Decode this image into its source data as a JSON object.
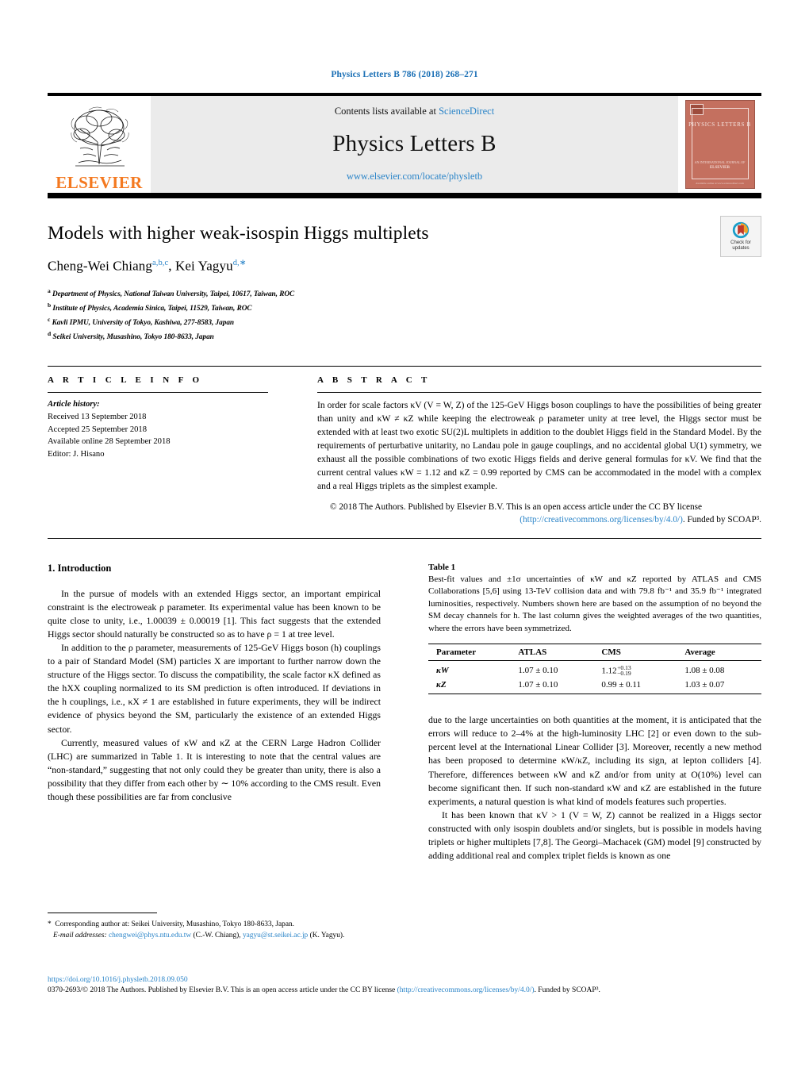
{
  "running_head": "Physics Letters B 786 (2018) 268–271",
  "masthead": {
    "publisher": "ELSEVIER",
    "contents_prefix": "Contents lists available at ",
    "contents_link": "ScienceDirect",
    "journal_name": "Physics Letters B",
    "journal_url": "www.elsevier.com/locate/physletb",
    "cover_title": "PHYSICS LETTERS B",
    "cover_footer_line1": "AN INTERNATIONAL JOURNAL OF",
    "cover_footer_line2": "ELSEVIER",
    "cover_bottom": "Available online at www.sciencedirect.com"
  },
  "article": {
    "title": "Models with higher weak-isospin Higgs multiplets",
    "authors": [
      {
        "name": "Cheng-Wei Chiang",
        "marks": "a,b,c",
        "sep": ", "
      },
      {
        "name": "Kei Yagyu",
        "marks": "d,∗",
        "sep": ""
      }
    ],
    "affiliations": [
      {
        "mark": "a",
        "text": "Department of Physics, National Taiwan University, Taipei, 10617, Taiwan, ROC"
      },
      {
        "mark": "b",
        "text": "Institute of Physics, Academia Sinica, Taipei, 11529, Taiwan, ROC"
      },
      {
        "mark": "c",
        "text": "Kavli IPMU, University of Tokyo, Kashiwa, 277-8583, Japan"
      },
      {
        "mark": "d",
        "text": "Seikei University, Musashino, Tokyo 180-8633, Japan"
      }
    ],
    "crossmark_label_line1": "Check for",
    "crossmark_label_line2": "updates"
  },
  "article_info": {
    "heading": "A R T I C L E   I N F O",
    "history_label": "Article history:",
    "received": "Received 13 September 2018",
    "accepted": "Accepted 25 September 2018",
    "available": "Available online 28 September 2018",
    "editor": "Editor: J. Hisano"
  },
  "abstract": {
    "heading": "A B S T R A C T",
    "text": "In order for scale factors κV (V = W, Z) of the 125-GeV Higgs boson couplings to have the possibilities of being greater than unity and κW ≠ κZ while keeping the electroweak ρ parameter unity at tree level, the Higgs sector must be extended with at least two exotic SU(2)L multiplets in addition to the doublet Higgs field in the Standard Model. By the requirements of perturbative unitarity, no Landau pole in gauge couplings, and no accidental global U(1) symmetry, we exhaust all the possible combinations of two exotic Higgs fields and derive general formulas for κV. We find that the current central values κW = 1.12 and κZ = 0.99 reported by CMS can be accommodated in the model with a complex and a real Higgs triplets as the simplest example.",
    "copyright_lead": "© 2018 The Authors. Published by Elsevier B.V. This is an open access article under the CC BY license",
    "copyright_link": "(http://creativecommons.org/licenses/by/4.0/)",
    "copyright_tail": ". Funded by SCOAP³."
  },
  "section_intro": {
    "heading": "1. Introduction",
    "p1": "In the pursue of models with an extended Higgs sector, an important empirical constraint is the electroweak ρ parameter. Its experimental value has been known to be quite close to unity, i.e., 1.00039 ± 0.00019 [1]. This fact suggests that the extended Higgs sector should naturally be constructed so as to have ρ = 1 at tree level.",
    "p2": "In addition to the ρ parameter, measurements of 125-GeV Higgs boson (h) couplings to a pair of Standard Model (SM) particles X are important to further narrow down the structure of the Higgs sector. To discuss the compatibility, the scale factor κX defined as the hXX coupling normalized to its SM prediction is often introduced. If deviations in the h couplings, i.e., κX ≠ 1 are established in future experiments, they will be indirect evidence of physics beyond the SM, particularly the existence of an extended Higgs sector.",
    "p3": "Currently, measured values of κW and κZ at the CERN Large Hadron Collider (LHC) are summarized in Table 1. It is interesting to note that the central values are “non-standard,” suggesting that not only could they be greater than unity, there is also a possibility that they differ from each other by ∼ 10% according to the CMS result. Even though these possibilities are far from conclusive",
    "p4": "due to the large uncertainties on both quantities at the moment, it is anticipated that the errors will reduce to 2–4% at the high-luminosity LHC [2] or even down to the sub-percent level at the International Linear Collider [3]. Moreover, recently a new method has been proposed to determine κW/κZ, including its sign, at lepton colliders [4]. Therefore, differences between κW and κZ and/or from unity at O(10%) level can become significant then. If such non-standard κW and κZ are established in the future experiments, a natural question is what kind of models features such properties.",
    "p5": "It has been known that κV > 1 (V = W, Z) cannot be realized in a Higgs sector constructed with only isospin doublets and/or singlets, but is possible in models having triplets or higher multiplets [7,8]. The Georgi–Machacek (GM) model [9] constructed by adding additional real and complex triplet fields is known as one"
  },
  "table1": {
    "label": "Table 1",
    "caption": "Best-fit values and ±1σ uncertainties of κW and κZ reported by ATLAS and CMS Collaborations [5,6] using 13-TeV collision data and with 79.8 fb⁻¹ and 35.9 fb⁻¹ integrated luminosities, respectively. Numbers shown here are based on the assumption of no beyond the SM decay channels for h. The last column gives the weighted averages of the two quantities, where the errors have been symmetrized.",
    "columns": [
      "Parameter",
      "ATLAS",
      "CMS",
      "Average"
    ],
    "rows": [
      {
        "parameter": "κW",
        "atlas": "1.07 ± 0.10",
        "cms": "1.12",
        "cms_sup": "+0.13",
        "cms_sub": "−0.19",
        "average": "1.08 ± 0.08"
      },
      {
        "parameter": "κZ",
        "atlas": "1.07 ± 0.10",
        "cms": "0.99 ± 0.11",
        "cms_sup": "",
        "cms_sub": "",
        "average": "1.03 ± 0.07"
      }
    ]
  },
  "footnotes": {
    "corresponding": "Corresponding author at: Seikei University, Musashino, Tokyo 180-8633, Japan.",
    "email_label": "E-mail addresses:",
    "email1": "chengwei@phys.ntu.edu.tw",
    "email1_owner": "(C.-W. Chiang),",
    "email2": "yagyu@st.seikei.ac.jp",
    "email2_owner": "(K. Yagyu)."
  },
  "bottom": {
    "doi": "https://doi.org/10.1016/j.physletb.2018.09.050",
    "issn_line": "0370-2693/© 2018 The Authors. Published by Elsevier B.V. This is an open access article under the CC BY license ",
    "license_link": "(http://creativecommons.org/licenses/by/4.0/)",
    "funded": ". Funded by SCOAP³."
  },
  "colors": {
    "link": "#2a84c8",
    "elsevier_orange": "#F47920",
    "cover_red": "#c4705f"
  }
}
